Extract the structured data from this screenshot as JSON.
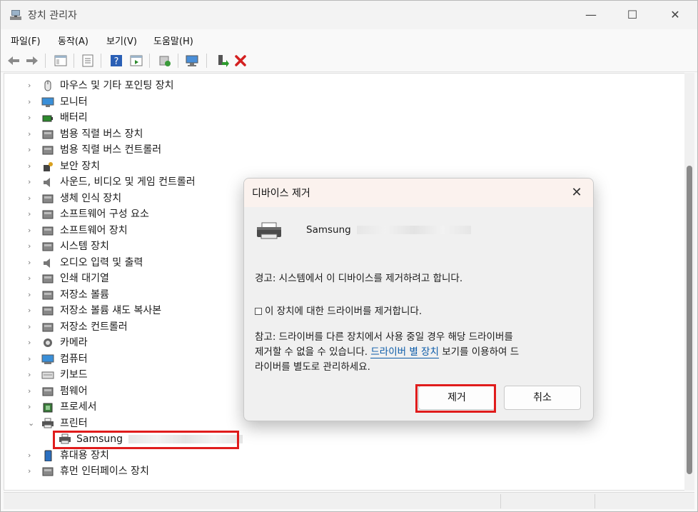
{
  "window": {
    "title": "장치 관리자",
    "minimize": "—",
    "maximize": "☐",
    "close": "✕"
  },
  "menu": [
    "파일(F)",
    "동작(A)",
    "보기(V)",
    "도움말(H)"
  ],
  "toolbar": {
    "icons": [
      "back-arrow-icon",
      "forward-arrow-icon",
      "show-hide-tree-icon",
      "properties-icon",
      "help-icon",
      "action-pane-icon",
      "update-driver-icon",
      "scan-hardware-icon",
      "enable-device-icon",
      "uninstall-device-icon"
    ]
  },
  "tree": {
    "items": [
      {
        "label": "마우스 및 기타 포인팅 장치",
        "icon": "mouse-icon"
      },
      {
        "label": "모니터",
        "icon": "monitor-icon"
      },
      {
        "label": "배터리",
        "icon": "battery-icon"
      },
      {
        "label": "범용 직렬 버스 장치",
        "icon": "usb-device-icon"
      },
      {
        "label": "범용 직렬 버스 컨트롤러",
        "icon": "usb-controller-icon"
      },
      {
        "label": "보안 장치",
        "icon": "security-device-icon"
      },
      {
        "label": "사운드, 비디오 및 게임 컨트롤러",
        "icon": "sound-icon"
      },
      {
        "label": "생체 인식 장치",
        "icon": "biometric-icon"
      },
      {
        "label": "소프트웨어 구성 요소",
        "icon": "software-component-icon"
      },
      {
        "label": "소프트웨어 장치",
        "icon": "software-device-icon"
      },
      {
        "label": "시스템 장치",
        "icon": "system-device-icon"
      },
      {
        "label": "오디오 입력 및 출력",
        "icon": "audio-io-icon"
      },
      {
        "label": "인쇄 대기열",
        "icon": "print-queue-icon"
      },
      {
        "label": "저장소 볼륨",
        "icon": "storage-volume-icon"
      },
      {
        "label": "저장소 볼륨 섀도 복사본",
        "icon": "shadow-copy-icon"
      },
      {
        "label": "저장소 컨트롤러",
        "icon": "storage-controller-icon"
      },
      {
        "label": "카메라",
        "icon": "camera-icon"
      },
      {
        "label": "컴퓨터",
        "icon": "computer-icon"
      },
      {
        "label": "키보드",
        "icon": "keyboard-icon"
      },
      {
        "label": "펌웨어",
        "icon": "firmware-icon"
      },
      {
        "label": "프로세서",
        "icon": "processor-icon"
      },
      {
        "label": "프린터",
        "icon": "printer-icon",
        "expanded": true
      },
      {
        "label": "휴대용 장치",
        "icon": "portable-device-icon"
      },
      {
        "label": "휴먼 인터페이스 장치",
        "icon": "hid-icon"
      }
    ],
    "child": {
      "label": "Samsung",
      "icon": "printer-icon"
    },
    "chevron_collapsed": "›",
    "chevron_expanded": "⌄"
  },
  "dialog": {
    "title": "디바이스 제거",
    "close": "✕",
    "device_name": "Samsung",
    "warning": "경고: 시스템에서 이 디바이스를 제거하려고 합니다.",
    "checkbox_label": "이 장치에 대한 드라이버를 제거합니다.",
    "note_line1": "참고: 드라이버를 다른 장치에서 사용 중일 경우 해당 드라이버를",
    "note_line2_pre": "제거할 수 없을 수 있습니다. ",
    "note_link": "드라이버 별 장치",
    "note_line2_post": " 보기를 이용하여 드",
    "note_line3": "라이버를 별도로 관리하세요.",
    "remove_button": "제거",
    "cancel_button": "취소"
  },
  "colors": {
    "highlight": "#e01c1c",
    "link": "#0a5aa8",
    "uninstall": "#d42020"
  }
}
